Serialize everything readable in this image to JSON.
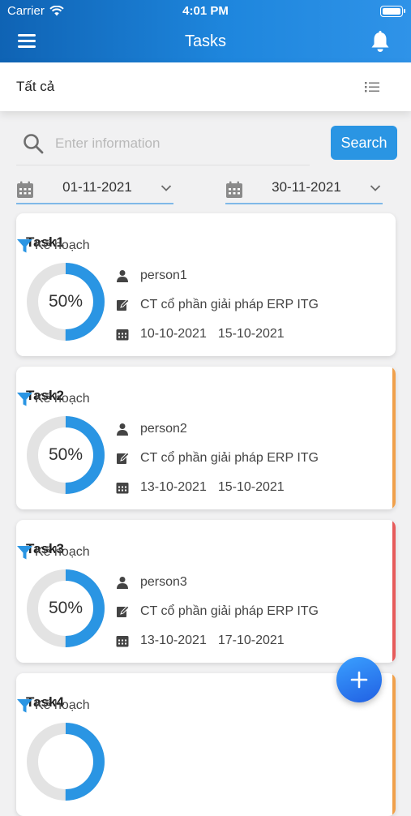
{
  "status_bar": {
    "carrier": "Carrier",
    "time": "4:01 PM"
  },
  "header": {
    "title": "Tasks"
  },
  "filter": {
    "label": "Tất cả"
  },
  "search": {
    "placeholder": "Enter information",
    "button": "Search"
  },
  "date_range": {
    "from": "01-11-2021",
    "to": "30-11-2021"
  },
  "colors": {
    "primary": "#2a95e3",
    "header_start": "#0f63b4",
    "accent_orange": "#f0a04b",
    "accent_red": "#e65b5b"
  },
  "tasks": [
    {
      "name": "Task1",
      "status": "Kế hoạch",
      "progress": 50,
      "progress_label": "50%",
      "person": "person1",
      "company": "CT cổ phần giải pháp ERP ITG",
      "start": "10-10-2021",
      "end": "15-10-2021",
      "accent": ""
    },
    {
      "name": "Task2",
      "status": "Kế hoạch",
      "progress": 50,
      "progress_label": "50%",
      "person": "person2",
      "company": "CT cổ phần giải pháp ERP ITG",
      "start": "13-10-2021",
      "end": "15-10-2021",
      "accent": "orange"
    },
    {
      "name": "Task3",
      "status": "Kế hoạch",
      "progress": 50,
      "progress_label": "50%",
      "person": "person3",
      "company": "CT cổ phần giải pháp ERP ITG",
      "start": "13-10-2021",
      "end": "17-10-2021",
      "accent": "red"
    },
    {
      "name": "Task4",
      "status": "Kế hoạch",
      "progress": 50,
      "progress_label": "50%",
      "accent": "orange"
    }
  ]
}
